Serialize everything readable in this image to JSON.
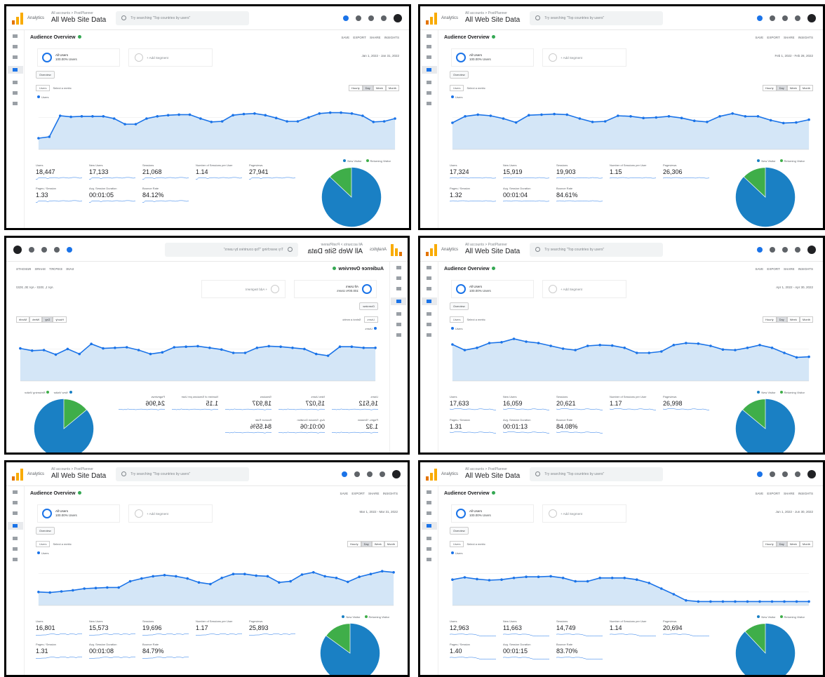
{
  "common": {
    "app_name": "Analytics",
    "account_crumb": "All accounts > PostPlanner",
    "view_label": "All Web Site Data",
    "search_placeholder": "Try searching \"Top countries by users\"",
    "page_title": "Audience Overview",
    "actions": "SAVE  EXPORT  SHARE  INSIGHTS",
    "segment_name": "All Users",
    "segment_sub": "100.00% Users",
    "add_segment": "+ Add Segment",
    "overview_btn": "Overview",
    "metric_select": "Users",
    "vs_select": "Select a metric",
    "granularity": [
      "Hourly",
      "Day",
      "Week",
      "Month"
    ],
    "series_name": "Users",
    "legend_new": "New Visitor",
    "legend_returning": "Returning Visitor",
    "metric_labels": [
      "Users",
      "New Users",
      "Sessions",
      "Number of Sessions per User",
      "Pageviews",
      "Pages / Session",
      "Avg. Session Duration",
      "Bounce Rate"
    ],
    "colors": {
      "line": "#1a73e8",
      "fill": "#d4e6f7",
      "pie_new": "#1a80c4",
      "pie_return": "#3fae49"
    }
  },
  "panels": [
    {
      "date_range": "Jan 1, 2022 - Jan 31, 2022",
      "values": [
        "18,447",
        "17,133",
        "21,068",
        "1.14",
        "27,941",
        "1.33",
        "00:01:05",
        "84.12%"
      ],
      "series": [
        40,
        45,
        120,
        116,
        118,
        118,
        118,
        110,
        90,
        90,
        110,
        118,
        122,
        124,
        124,
        110,
        98,
        100,
        122,
        126,
        128,
        122,
        112,
        100,
        100,
        114,
        128,
        131,
        131,
        128,
        120,
        98,
        100,
        110
      ],
      "pie_returning_pct": 13
    },
    {
      "date_range": "Feb 1, 2022 - Feb 28, 2022",
      "values": [
        "17,324",
        "15,919",
        "19,903",
        "1.15",
        "26,306",
        "1.32",
        "00:01:04",
        "84.61%"
      ],
      "series": [
        95,
        118,
        124,
        120,
        110,
        96,
        122,
        124,
        126,
        124,
        110,
        98,
        100,
        120,
        118,
        112,
        114,
        118,
        112,
        102,
        98,
        118,
        128,
        118,
        118,
        104,
        94,
        96,
        106
      ],
      "pie_returning_pct": 13
    },
    {
      "date_range": "Apr 1, 2022 - Apr 30, 2022",
      "values": [
        "16,512",
        "15,027",
        "18,937",
        "1.15",
        "24,906",
        "1.32",
        "00:01:06",
        "84.55%"
      ],
      "series": [
        118,
        118,
        122,
        122,
        90,
        96,
        114,
        118,
        122,
        124,
        118,
        100,
        100,
        112,
        118,
        124,
        122,
        120,
        102,
        96,
        110,
        120,
        118,
        116,
        132,
        96,
        114,
        94,
        110,
        108,
        116
      ],
      "pie_returning_pct": 14,
      "mirrored": true
    },
    {
      "date_range": "Apr 1, 2022 - Apr 30, 2022",
      "values": [
        "17,633",
        "16,059",
        "20,621",
        "1.17",
        "26,998",
        "1.31",
        "00:01:13",
        "84.08%"
      ],
      "series": [
        130,
        110,
        118,
        135,
        138,
        150,
        140,
        135,
        125,
        115,
        110,
        125,
        128,
        126,
        118,
        100,
        100,
        105,
        128,
        135,
        133,
        125,
        112,
        110,
        118,
        128,
        118,
        100,
        84,
        86
      ],
      "pie_returning_pct": 14
    },
    {
      "date_range": "Mar 1, 2022 - Mar 31, 2022",
      "values": [
        "16,801",
        "15,573",
        "19,696",
        "1.17",
        "25,893",
        "1.31",
        "00:01:08",
        "84.79%"
      ],
      "series": [
        48,
        46,
        50,
        54,
        60,
        62,
        64,
        64,
        86,
        96,
        104,
        108,
        104,
        96,
        82,
        76,
        98,
        112,
        112,
        106,
        104,
        82,
        86,
        110,
        118,
        104,
        98,
        84,
        102,
        112,
        122,
        118
      ],
      "pie_returning_pct": 15
    },
    {
      "date_range": "Jun 1, 2022 - Jun 30, 2022",
      "values": [
        "12,963",
        "11,663",
        "14,749",
        "1.14",
        "20,694",
        "1.40",
        "00:01:15",
        "83.70%"
      ],
      "series": [
        92,
        100,
        94,
        90,
        92,
        98,
        102,
        102,
        104,
        98,
        86,
        86,
        98,
        98,
        98,
        92,
        80,
        60,
        40,
        18,
        14,
        14,
        14,
        14,
        14,
        14,
        14,
        14,
        14,
        14
      ],
      "pie_returning_pct": 12
    }
  ]
}
